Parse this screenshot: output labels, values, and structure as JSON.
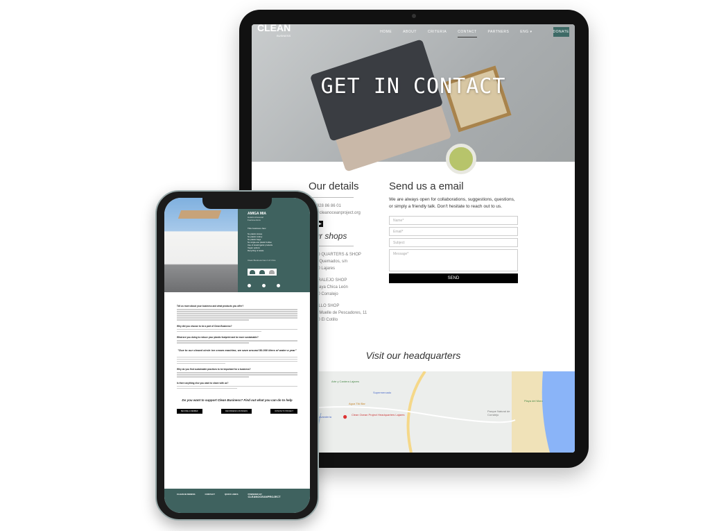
{
  "tablet": {
    "logo": "CLEAN",
    "logo_sub": "BUSINESS",
    "nav": [
      "HOME",
      "ABOUT",
      "CRITERIA",
      "CONTACT",
      "PARTNERS",
      "ENG ▾"
    ],
    "donate": "DONATE",
    "hero_title": "GET IN CONTACT",
    "details": {
      "title": "Our details",
      "phone": "+34 928 86 86 01",
      "email": "info@cleanoceanproject.org",
      "shops_title": "Our shops",
      "shops": [
        [
          "HEAD QUARTERS & SHOP",
          "Calle Quemados, s/n",
          "35650 Lajares"
        ],
        [
          "CORRALEJO SHOP",
          "Av. Playa Chica León",
          "35660 Corralejo"
        ],
        [
          "COTILLO SHOP",
          "Calle Muelle de Pescadores, 11",
          "35650 El Cotillo"
        ]
      ]
    },
    "form": {
      "title": "Send us a email",
      "text": "We are always open for collaborations, suggestions, questions, or simply a friendly talk. Don't hesitate to reach out to us.",
      "name": "Name*",
      "email": "Email*",
      "subject": "Subject",
      "message": "Message*",
      "send": "SEND"
    },
    "visit": "Visit our headquarters",
    "map": {
      "marker": "Clean Ocean Project Headquarters Lajares",
      "places": [
        "Arte y Cantera Lajares",
        "Supermercado",
        "Bodega Canaria",
        "Agua Tiki Bar",
        "Lavandería",
        "Playa del Moro",
        "Parque Natural de Corralejo"
      ]
    }
  },
  "phone": {
    "business": "AMIGA MIA",
    "business_sub": "Helado Artesanal",
    "business_loc": "Fuerteventura",
    "fins_title": "Clean Business has 2 of 3 fins",
    "criteria_title": "This business has:",
    "criteria": [
      "No plastic straws",
      "No plastic cutlery",
      "No plastic bags",
      "No single-use plastic bottles",
      "Use of local/organic products",
      "Vegan options",
      "Recycling of waste"
    ],
    "questions": [
      "Tell us more about your business and what products you offer?",
      "Why did you choose to be a part of Clean Business?",
      "What are you doing to reduce your plastic footprint and be more sustainable?",
      "Why do you find sustainable practices to be important for a business?",
      "Is there anything else you want to share with us?"
    ],
    "quote": "\"Due to our closed circle ice cream machine, we save around 50.000 liters of water a year\"",
    "cta": "Do you want to support Clean Business? Find out what you can do to help",
    "buttons": [
      "BECOME A MEMBER",
      "RECOMMEND A BUSINESS",
      "DONATE TO PROJECT"
    ],
    "footer": {
      "col1": "CLEAN BUSINESS",
      "col2": "CONTACT",
      "col3": "QUICK LINKS",
      "col4": "POWERED BY",
      "brand": "CLEANOCEANPROJECT"
    }
  },
  "colors": {
    "teal": "#3f625f",
    "button": "#000000"
  }
}
